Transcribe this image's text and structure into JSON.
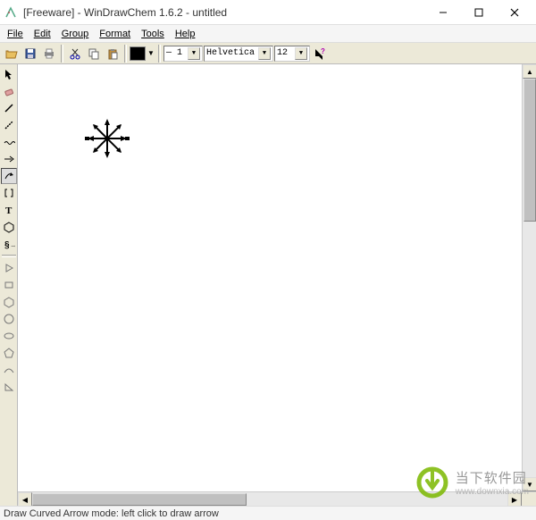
{
  "titlebar": {
    "title": "[Freeware] - WinDrawChem 1.6.2 - untitled"
  },
  "menu": {
    "file": "File",
    "edit": "Edit",
    "group": "Group",
    "format": "Format",
    "tools": "Tools",
    "help": "Help"
  },
  "toolbar": {
    "line_width": "1",
    "font_name": "Helvetica",
    "font_size": "12"
  },
  "status": {
    "text": "Draw Curved Arrow mode: left click to draw arrow"
  },
  "watermark": {
    "title": "当下软件园",
    "url": "www.downxia.com"
  },
  "colors": {
    "swatch": "#000000",
    "accent": "#7bb800"
  }
}
